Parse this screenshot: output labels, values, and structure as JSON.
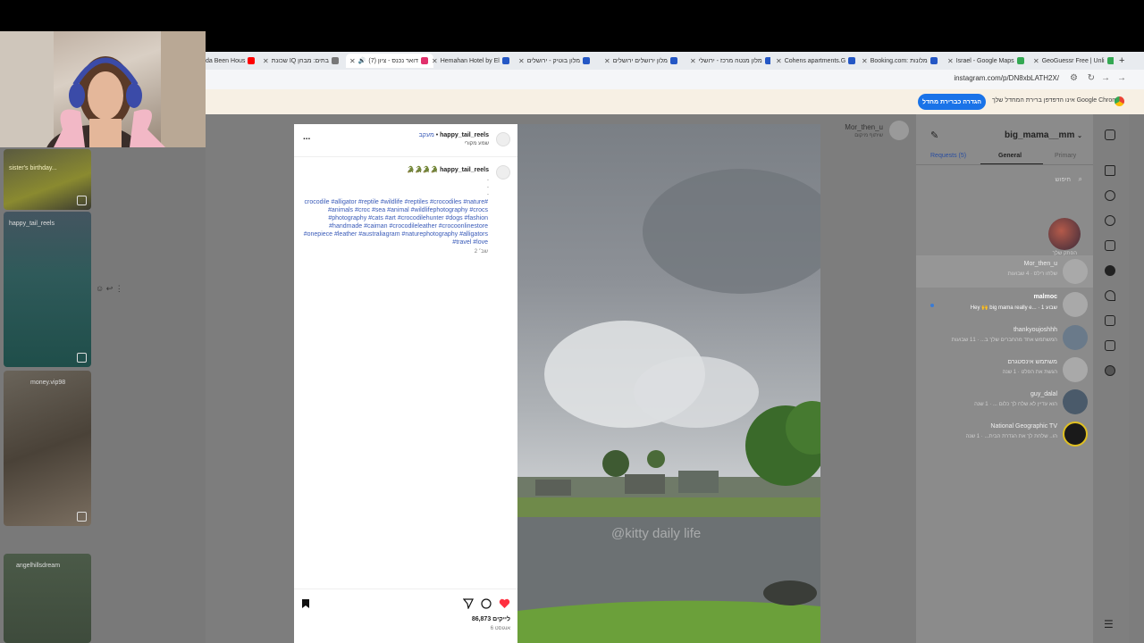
{
  "browser": {
    "tabs": [
      {
        "label": "da Been Hous",
        "color": "#ff0000"
      },
      {
        "label": "שכונת IQ בתים: מבחן",
        "color": "#777777"
      },
      {
        "label": "(7) דואר נכנס - ציון",
        "color": "#e1306c"
      },
      {
        "label": "Hemahan Hotel by El",
        "color": "#2457c5"
      },
      {
        "label": "מלון בוטיק - ירושלים",
        "color": "#2457c5"
      },
      {
        "label": "מלון ירושלים ירושלים",
        "color": "#2457c5"
      },
      {
        "label": "מלון מנטה מרכז - ירושלי",
        "color": "#2457c5"
      },
      {
        "label": "Cohens apartments.G",
        "color": "#2457c5"
      },
      {
        "label": "Booking.com: מלונות",
        "color": "#2457c5"
      },
      {
        "label": "Israel - Google Maps",
        "color": "#34a853"
      },
      {
        "label": "GeoGuessr Free | Unli",
        "color": "#34a853"
      }
    ],
    "url": "instagram.com/p/DN8xbLATH2X/",
    "infobar": {
      "text": "אינו הדפדפן ברירת המחדל שלך Google Chrome",
      "button": "הגדרה כברירת מחדל"
    }
  },
  "left_reels": [
    {
      "name": "sister's birthday..."
    },
    {
      "name": "happy_tail_reels"
    },
    {
      "name": "money.vip98"
    },
    {
      "name": "angelhillsdream"
    }
  ],
  "post": {
    "author": "happy_tail_reels",
    "follow": "מעקב",
    "audio": "שמע מקורי",
    "more": "...",
    "caption_author": "happy_tail_reels",
    "caption_emoji": "🐊🐊🐊🐊",
    "hashtags": "#crocodile #alligator #reptile #wildlife #reptiles #crocodiles #nature #animals #croc #sea #animal #wildlifephotography #crocs #photography #cats #art #crocodilehunter #dogs #fashion #handmade #caiman #crocodileleather #crocoonlinestore #onepiece #leather #australiagram #naturephotography #alligators #travel #love",
    "time": "2 שב׳",
    "likes": "86,873 לייקים",
    "date": "6 אוגוסט",
    "watermark": "@kitty daily life"
  },
  "messages": {
    "account": "big_mama__mm",
    "tabs": [
      "Requests (5)",
      "General",
      "Primary"
    ],
    "search_placeholder": "חיפוש",
    "top_note_user": "הפתק שלך",
    "header_user": "Mor_then_u",
    "header_sub": "שיתוף מיקום",
    "threads": [
      {
        "name": "Mor_then_u",
        "sub": "שלחו רילס · 4 שבועות"
      },
      {
        "name": "malmoc",
        "sub": "Hey 🙌 big mama really e... · 1 שבוע"
      },
      {
        "name": "thankyoujoshhh",
        "sub": "המשתמש אחד מהחברים שלך ב... · 11 שבועות"
      },
      {
        "name": "משתמש אינסטגרם",
        "sub": "הגשת את הפלט · 1 שנה"
      },
      {
        "name": "guy_dalal",
        "sub": "הוא עדיין לא שלח לך כלום ... · 1 שנה"
      },
      {
        "name": "National Geographic TV",
        "sub": "הו.. שלחת לך את הגדרת הבית... · 1 שנה"
      }
    ]
  }
}
